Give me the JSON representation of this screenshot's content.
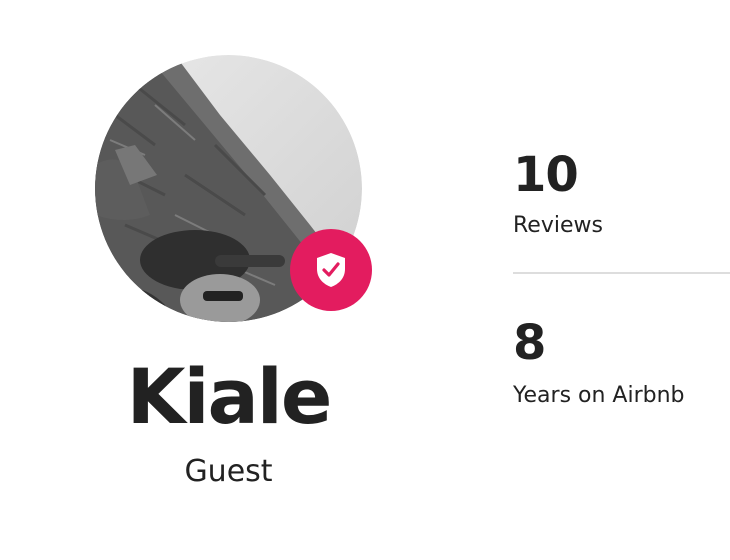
{
  "profile": {
    "name": "Kiale",
    "role": "Guest",
    "verified": true
  },
  "stats": [
    {
      "value": "10",
      "label": "Reviews"
    },
    {
      "value": "8",
      "label": "Years on Airbnb"
    }
  ],
  "colors": {
    "badge": "#E31C5F",
    "text": "#222222",
    "divider": "#DDDDDD"
  },
  "icons": {
    "badge_icon": "shield-check-icon"
  }
}
